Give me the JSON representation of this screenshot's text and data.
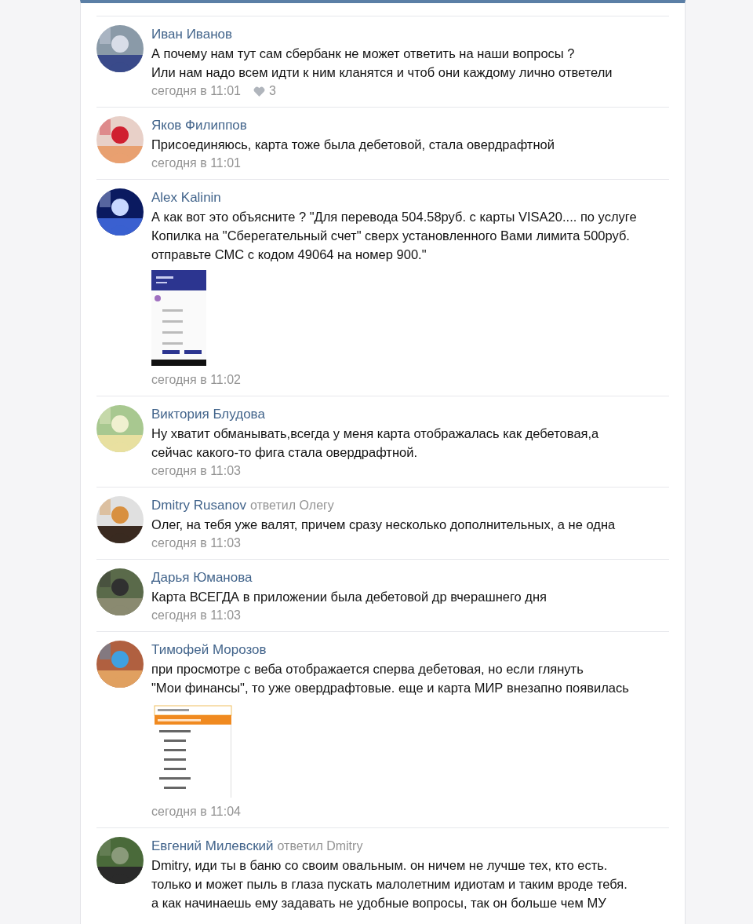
{
  "comments": [
    {
      "author": "Иван Иванов",
      "avatar": {
        "kind": "picture"
      },
      "text": [
        "А почему нам тут сам сбербанк не может ответить на наши вопросы ?",
        "Или нам надо всем идти к ним кланятся и чтоб они каждому лично ответели"
      ],
      "time": "сегодня в 11:01",
      "likes": "3"
    },
    {
      "author": "Яков Филиппов",
      "avatar": {
        "kind": "picture"
      },
      "text": [
        "Присоединяюсь, карта тоже была дебетовой, стала овердрафтной"
      ],
      "time": "сегодня в 11:01"
    },
    {
      "author": "Alex Kalinin",
      "avatar": {
        "kind": "picture"
      },
      "text": [
        "А как вот это объясните ? \"Для перевода 504.58руб. с карты VISA20.... по услуге",
        "Копилка на \"Сберегательный счет\" сверх установленного Вами лимита 500руб.",
        "отправьте СМС с кодом 49064 на номер 900.\""
      ],
      "attachment": {
        "kind": "phone"
      },
      "time": "сегодня в 11:02"
    },
    {
      "author": "Виктория Блудова",
      "avatar": {
        "kind": "picture"
      },
      "text": [
        "Ну хватит обманывать,всегда у меня карта отображалась как дебетовая,а",
        "сейчас какого-то фига стала овердрафтной."
      ],
      "time": "сегодня в 11:03"
    },
    {
      "author": "Dmitry Rusanov",
      "reply": "ответил Олегу",
      "avatar": {
        "kind": "picture"
      },
      "text": [
        "Олег, на тебя уже валят, причем сразу несколько дополнительных, а не одна"
      ],
      "time": "сегодня в 11:03"
    },
    {
      "author": "Дарья Юманова",
      "avatar": {
        "kind": "picture"
      },
      "text": [
        "Карта ВСЕГДА в приложении была дебетовой др вчерашнего дня"
      ],
      "time": "сегодня в 11:03"
    },
    {
      "author": "Тимофей Морозов",
      "avatar": {
        "kind": "picture"
      },
      "text": [
        "при просмотре с веба отображается сперва дебетовая, но если глянуть",
        "\"Мои финансы\", то уже овердрафтовые. еще и карта МИР внезапно появилась"
      ],
      "attachment": {
        "kind": "menu"
      },
      "time": "сегодня в 11:04"
    },
    {
      "author": "Евгений Милевский",
      "reply": "ответил Dmitry",
      "avatar": {
        "kind": "picture"
      },
      "text": [
        "Dmitry, иди ты в баню со своим овальным. он ничем не лучше тех, кто есть.",
        "только и может пыль в глаза пускать малолетним идиотам и таким вроде тебя.",
        "а как начинаешь ему задавать не удобные вопросы, так он больше чем МУ"
      ]
    }
  ]
}
